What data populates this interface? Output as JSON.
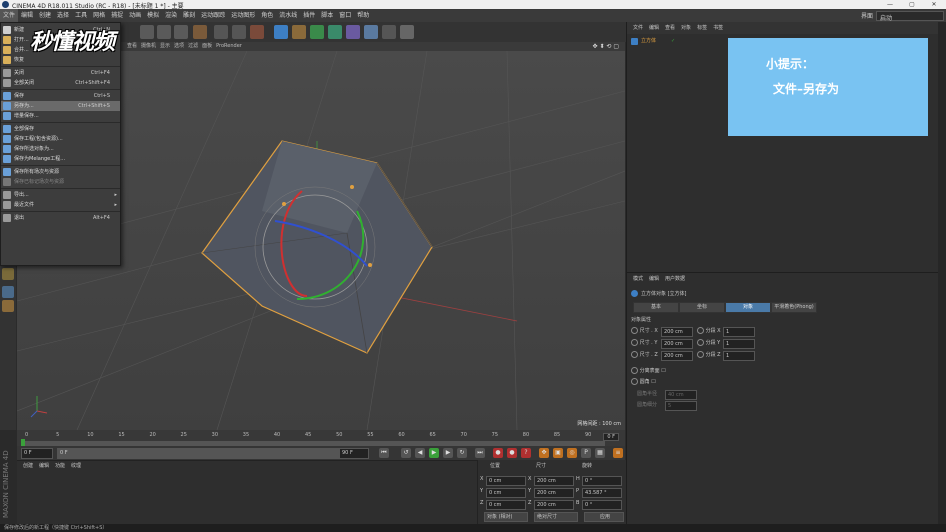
{
  "window": {
    "title": "CINEMA 4D R18.011 Studio (RC - R18) - [未标题 1 *] - 主要",
    "controls": [
      "—",
      "▢",
      "✕"
    ]
  },
  "menubar": {
    "items": [
      "文件",
      "编辑",
      "创建",
      "选择",
      "工具",
      "网格",
      "捕捉",
      "动画",
      "模拟",
      "渲染",
      "雕刻",
      "运动跟踪",
      "运动图形",
      "角色",
      "流水线",
      "插件",
      "脚本",
      "窗口",
      "帮助"
    ],
    "interface_label": "界面",
    "interface_value": "启动"
  },
  "watermark": "秒懂视频",
  "file_menu": {
    "items": [
      {
        "label": "新建",
        "shortcut": "Ctrl+N",
        "color": "#cfcfcf"
      },
      {
        "label": "打开...",
        "shortcut": "Ctrl+O",
        "color": "#d9b05a"
      },
      {
        "label": "合并...",
        "shortcut": "Ctrl+Shift+O",
        "color": "#d9b05a"
      },
      {
        "label": "恢复",
        "shortcut": "",
        "color": "#d9b05a"
      },
      {
        "sep": true
      },
      {
        "label": "关闭",
        "shortcut": "Ctrl+F4",
        "color": "#9a9a9a"
      },
      {
        "label": "全部关闭",
        "shortcut": "Ctrl+Shift+F4",
        "color": "#9a9a9a"
      },
      {
        "sep": true
      },
      {
        "label": "保存",
        "shortcut": "Ctrl+S",
        "color": "#6aa0d8"
      },
      {
        "label": "另存为...",
        "shortcut": "Ctrl+Shift+S",
        "color": "#6aa0d8",
        "highlight": true
      },
      {
        "label": "增量保存...",
        "shortcut": "",
        "color": "#6aa0d8"
      },
      {
        "sep": true
      },
      {
        "label": "全部保存",
        "shortcut": "",
        "color": "#6aa0d8"
      },
      {
        "label": "保存工程(包含资源)...",
        "shortcut": "",
        "color": "#6aa0d8"
      },
      {
        "label": "保存所选对象为...",
        "shortcut": "",
        "color": "#6aa0d8"
      },
      {
        "label": "保存为Melange工程...",
        "shortcut": "",
        "color": "#6aa0d8"
      },
      {
        "sep": true
      },
      {
        "label": "保存所有场次与资源",
        "shortcut": "",
        "color": "#6aa0d8"
      },
      {
        "label": "保存已标记场次与资源",
        "shortcut": "",
        "color": "#777",
        "disabled": true
      },
      {
        "sep": true
      },
      {
        "label": "导出...",
        "shortcut": "",
        "color": "#9a9a9a",
        "submenu": true
      },
      {
        "label": "最近文件",
        "shortcut": "",
        "color": "#9a9a9a",
        "submenu": true
      },
      {
        "sep": true
      },
      {
        "label": "退出",
        "shortcut": "Alt+F4",
        "color": "#9a9a9a"
      }
    ]
  },
  "viewport": {
    "header_items": [
      "查看",
      "摄像机",
      "显示",
      "选项",
      "过滤",
      "面板",
      "ProRender"
    ],
    "grid_info": "网格间距 : 100 cm"
  },
  "timeline": {
    "ticks": [
      "0",
      "5",
      "10",
      "15",
      "20",
      "25",
      "30",
      "35",
      "40",
      "45",
      "50",
      "55",
      "60",
      "65",
      "70",
      "75",
      "80",
      "85",
      "90"
    ],
    "current_frame": "0 F"
  },
  "playback": {
    "start": "0 F",
    "current": "0 F",
    "end_a": "90 F",
    "end_b": "90 F"
  },
  "materials": {
    "tabs": [
      "创建",
      "编辑",
      "功能",
      "纹理"
    ]
  },
  "coords": {
    "headers": [
      "位置",
      "尺寸",
      "旋转"
    ],
    "rows": [
      {
        "axis": "X",
        "pos": "0 cm",
        "size": "200 cm",
        "rot_axis": "H",
        "rot": "0 °"
      },
      {
        "axis": "Y",
        "pos": "0 cm",
        "size": "200 cm",
        "rot_axis": "P",
        "rot": "43.587 °"
      },
      {
        "axis": "Z",
        "pos": "0 cm",
        "size": "200 cm",
        "rot_axis": "B",
        "rot": "0 °"
      }
    ],
    "mode_object": "对象 (相对)",
    "mode_size": "绝对尺寸",
    "apply": "应用"
  },
  "status": "保存修改后的新工程（快捷键 Ctrl+Shift+S）",
  "side_logo": "MAXON CINEMA 4D",
  "object_manager": {
    "menu": [
      "文件",
      "编辑",
      "查看",
      "对象",
      "标签",
      "书签"
    ],
    "object_name": "立方体"
  },
  "tip": {
    "title": "小提示：",
    "body": "文件–另存为"
  },
  "attributes": {
    "menu": [
      "模式",
      "编辑",
      "用户数据"
    ],
    "object_title": "立方体对象 [立方体]",
    "tabs": [
      "基本",
      "坐标",
      "对象",
      "平滑着色(Phong)"
    ],
    "section": "对象属性",
    "size_x_label": "尺寸 . X",
    "size_x": "200 cm",
    "size_y_label": "尺寸 . Y",
    "size_y": "200 cm",
    "size_z_label": "尺寸 . Z",
    "size_z": "200 cm",
    "seg_x_label": "分段 X",
    "seg_x": "1",
    "seg_y_label": "分段 Y",
    "seg_y": "1",
    "seg_z_label": "分段 Z",
    "seg_z": "1",
    "sep_surface": "分离表面",
    "fillet": "圆角",
    "fillet_radius_label": "圆角半径",
    "fillet_radius": "40 cm",
    "fillet_sub_label": "圆角细分",
    "fillet_sub": "5"
  },
  "colors": {
    "accent_blue": "#4a7aa8",
    "tip_bg": "#79c3f2",
    "cube_edge": "#e0a040"
  }
}
